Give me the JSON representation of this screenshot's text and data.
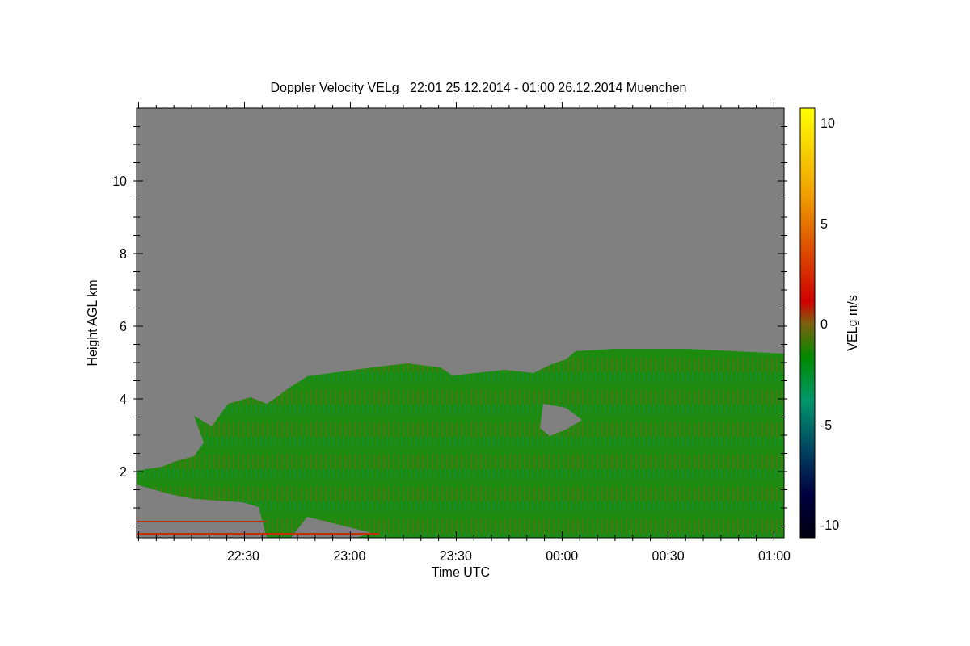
{
  "chart": {
    "title": "Doppler Velocity VELg   22:01 25.12.2014 - 01:00 26.12.2014 Muenchen",
    "x_axis": {
      "label": "Time UTC",
      "ticks": [
        "22:30",
        "23:00",
        "23:30",
        "00:00",
        "00:30",
        "01:00"
      ]
    },
    "y_axis": {
      "label": "Height AGL km",
      "ticks": [
        "10",
        "8",
        "6",
        "4",
        "2"
      ]
    },
    "colorbar": {
      "label": "VELg m/s",
      "ticks": [
        "10",
        "5",
        "0",
        "-5",
        "-10"
      ]
    }
  }
}
